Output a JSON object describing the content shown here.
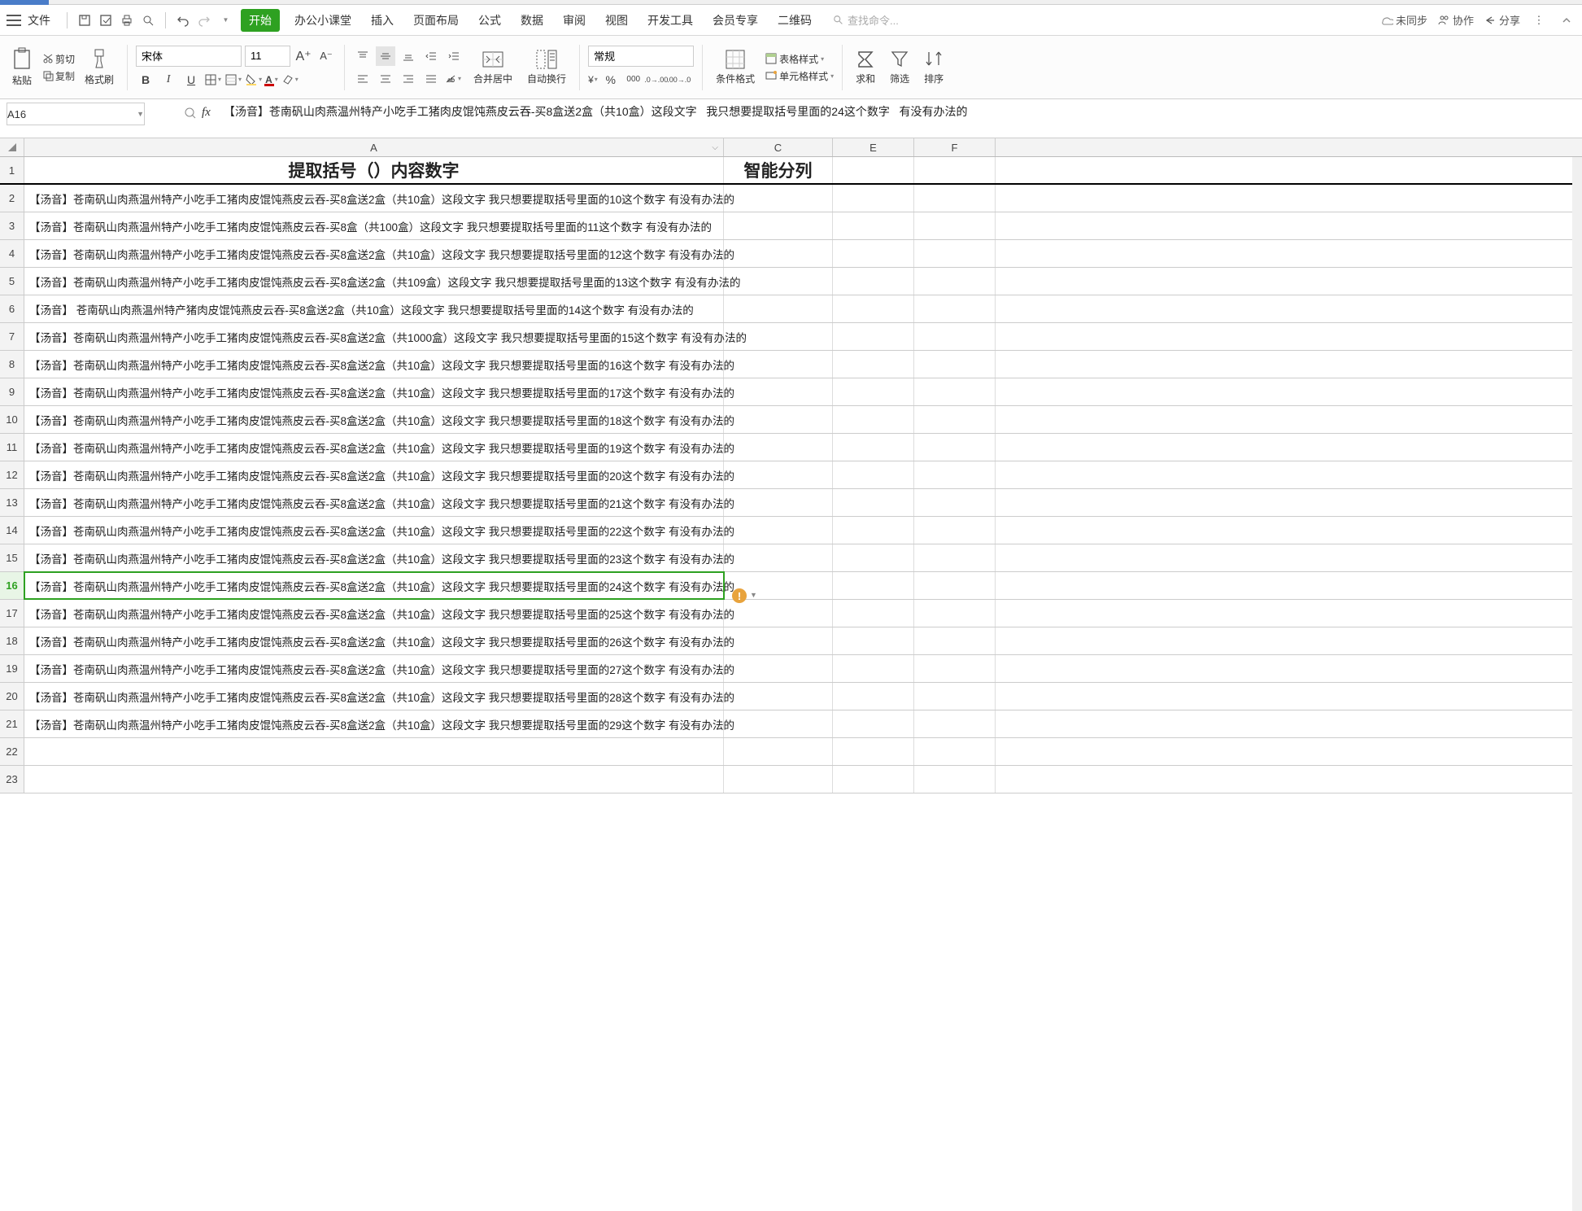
{
  "menubar": {
    "file_label": "文件",
    "tabs": [
      "开始",
      "办公小课堂",
      "插入",
      "页面布局",
      "公式",
      "数据",
      "审阅",
      "视图",
      "开发工具",
      "会员专享",
      "二维码"
    ],
    "search_placeholder": "查找命令...",
    "right": {
      "sync": "未同步",
      "collab": "协作",
      "share": "分享"
    }
  },
  "ribbon": {
    "paste": "粘贴",
    "cut": "剪切",
    "copy": "复制",
    "format_painter": "格式刷",
    "font_name": "宋体",
    "font_size": "11",
    "merge_center": "合并居中",
    "wrap": "自动换行",
    "number_format": "常规",
    "cond_format": "条件格式",
    "table_style": "表格样式",
    "cell_style": "单元格样式",
    "sum": "求和",
    "filter": "筛选",
    "sort": "排序"
  },
  "fx": {
    "name_box": "A16",
    "formula": "【汤音】苍南矾山肉燕温州特产小吃手工猪肉皮馄饨燕皮云吞-买8盒送2盒（共10盒）这段文字   我只想要提取括号里面的24这个数字   有没有办法的"
  },
  "headers": {
    "A": "A",
    "C": "C",
    "E": "E",
    "F": "F"
  },
  "title_a": "提取括号（）内容数字",
  "title_c": "智能分列",
  "rows": [
    {
      "n": 2,
      "a": "【汤音】苍南矾山肉燕温州特产小吃手工猪肉皮馄饨燕皮云吞-买8盒送2盒（共10盒）这段文字   我只想要提取括号里面的10这个数字   有没有办法的"
    },
    {
      "n": 3,
      "a": "【汤音】苍南矾山肉燕温州特产小吃手工猪肉皮馄饨燕皮云吞-买8盒（共100盒）这段文字   我只想要提取括号里面的11这个数字   有没有办法的"
    },
    {
      "n": 4,
      "a": "【汤音】苍南矾山肉燕温州特产小吃手工猪肉皮馄饨燕皮云吞-买8盒送2盒（共10盒）这段文字   我只想要提取括号里面的12这个数字   有没有办法的"
    },
    {
      "n": 5,
      "a": "【汤音】苍南矾山肉燕温州特产小吃手工猪肉皮馄饨燕皮云吞-买8盒送2盒（共109盒）这段文字   我只想要提取括号里面的13这个数字   有没有办法的"
    },
    {
      "n": 6,
      "a": "【汤音】  苍南矾山肉燕温州特产猪肉皮馄饨燕皮云吞-买8盒送2盒（共10盒）这段文字    我只想要提取括号里面的14这个数字    有没有办法的"
    },
    {
      "n": 7,
      "a": "【汤音】苍南矾山肉燕温州特产小吃手工猪肉皮馄饨燕皮云吞-买8盒送2盒（共1000盒）这段文字   我只想要提取括号里面的15这个数字   有没有办法的"
    },
    {
      "n": 8,
      "a": "【汤音】苍南矾山肉燕温州特产小吃手工猪肉皮馄饨燕皮云吞-买8盒送2盒（共10盒）这段文字   我只想要提取括号里面的16这个数字   有没有办法的"
    },
    {
      "n": 9,
      "a": "【汤音】苍南矾山肉燕温州特产小吃手工猪肉皮馄饨燕皮云吞-买8盒送2盒（共10盒）这段文字   我只想要提取括号里面的17这个数字   有没有办法的"
    },
    {
      "n": 10,
      "a": "【汤音】苍南矾山肉燕温州特产小吃手工猪肉皮馄饨燕皮云吞-买8盒送2盒（共10盒）这段文字   我只想要提取括号里面的18这个数字   有没有办法的"
    },
    {
      "n": 11,
      "a": "【汤音】苍南矾山肉燕温州特产小吃手工猪肉皮馄饨燕皮云吞-买8盒送2盒（共10盒）这段文字   我只想要提取括号里面的19这个数字   有没有办法的"
    },
    {
      "n": 12,
      "a": "【汤音】苍南矾山肉燕温州特产小吃手工猪肉皮馄饨燕皮云吞-买8盒送2盒（共10盒）这段文字   我只想要提取括号里面的20这个数字   有没有办法的"
    },
    {
      "n": 13,
      "a": "【汤音】苍南矾山肉燕温州特产小吃手工猪肉皮馄饨燕皮云吞-买8盒送2盒（共10盒）这段文字   我只想要提取括号里面的21这个数字   有没有办法的"
    },
    {
      "n": 14,
      "a": "【汤音】苍南矾山肉燕温州特产小吃手工猪肉皮馄饨燕皮云吞-买8盒送2盒（共10盒）这段文字   我只想要提取括号里面的22这个数字   有没有办法的"
    },
    {
      "n": 15,
      "a": "【汤音】苍南矾山肉燕温州特产小吃手工猪肉皮馄饨燕皮云吞-买8盒送2盒（共10盒）这段文字   我只想要提取括号里面的23这个数字   有没有办法的"
    },
    {
      "n": 16,
      "a": "【汤音】苍南矾山肉燕温州特产小吃手工猪肉皮馄饨燕皮云吞-买8盒送2盒（共10盒）这段文字   我只想要提取括号里面的24这个数字   有没有办法的",
      "selected": true
    },
    {
      "n": 17,
      "a": "【汤音】苍南矾山肉燕温州特产小吃手工猪肉皮馄饨燕皮云吞-买8盒送2盒（共10盒）这段文字   我只想要提取括号里面的25这个数字   有没有办法的"
    },
    {
      "n": 18,
      "a": "【汤音】苍南矾山肉燕温州特产小吃手工猪肉皮馄饨燕皮云吞-买8盒送2盒（共10盒）这段文字   我只想要提取括号里面的26这个数字   有没有办法的"
    },
    {
      "n": 19,
      "a": "【汤音】苍南矾山肉燕温州特产小吃手工猪肉皮馄饨燕皮云吞-买8盒送2盒（共10盒）这段文字   我只想要提取括号里面的27这个数字   有没有办法的"
    },
    {
      "n": 20,
      "a": "【汤音】苍南矾山肉燕温州特产小吃手工猪肉皮馄饨燕皮云吞-买8盒送2盒（共10盒）这段文字   我只想要提取括号里面的28这个数字   有没有办法的"
    },
    {
      "n": 21,
      "a": "【汤音】苍南矾山肉燕温州特产小吃手工猪肉皮馄饨燕皮云吞-买8盒送2盒（共10盒）这段文字   我只想要提取括号里面的29这个数字   有没有办法的"
    },
    {
      "n": 22,
      "a": ""
    },
    {
      "n": 23,
      "a": ""
    }
  ]
}
